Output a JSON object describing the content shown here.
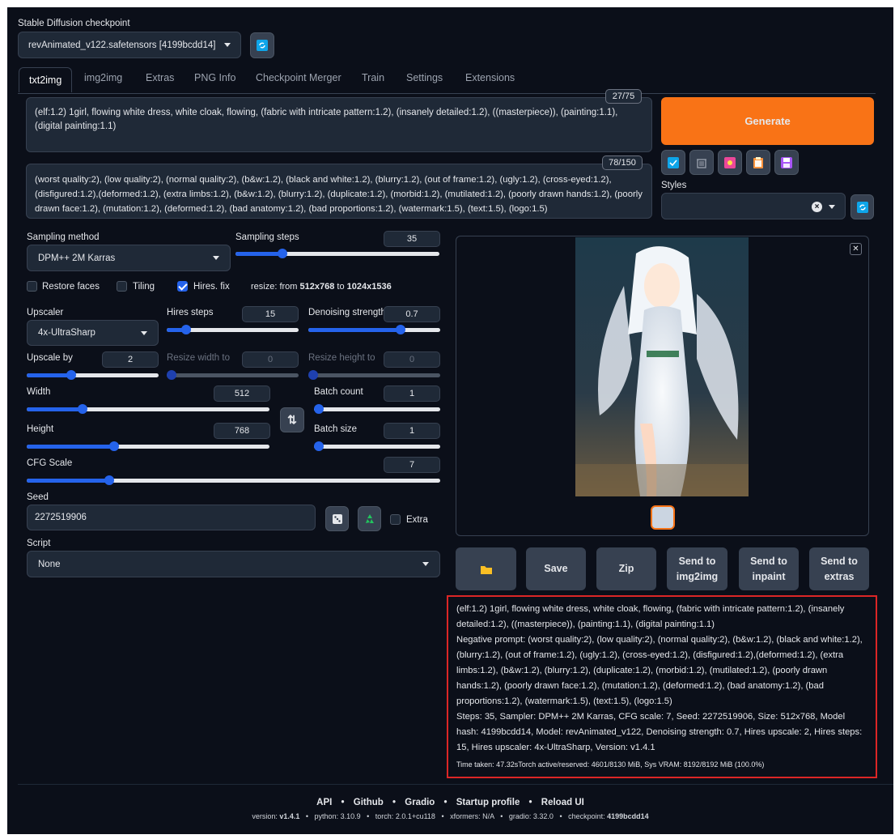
{
  "checkpoint": {
    "label": "Stable Diffusion checkpoint",
    "value": "revAnimated_v122.safetensors [4199bcdd14]"
  },
  "tabs": [
    "txt2img",
    "img2img",
    "Extras",
    "PNG Info",
    "Checkpoint Merger",
    "Train",
    "Settings",
    "Extensions"
  ],
  "prompt": {
    "text": "(elf:1.2) 1girl, flowing white dress, white cloak, flowing, (fabric with intricate pattern:1.2), (insanely detailed:1.2), ((masterpiece)), (painting:1.1), (digital painting:1.1)",
    "counter": "27/75"
  },
  "negative_prompt": {
    "text": "(worst quality:2), (low quality:2), (normal quality:2), (b&w:1.2), (black and white:1.2), (blurry:1.2), (out of frame:1.2), (ugly:1.2), (cross-eyed:1.2), (disfigured:1.2),(deformed:1.2), (extra limbs:1.2), (b&w:1.2), (blurry:1.2), (duplicate:1.2), (morbid:1.2), (mutilated:1.2), (poorly drawn hands:1.2), (poorly drawn face:1.2), (mutation:1.2), (deformed:1.2), (bad anatomy:1.2), (bad proportions:1.2), (watermark:1.5), (text:1.5), (logo:1.5)",
    "counter": "78/150"
  },
  "generate_label": "Generate",
  "styles_label": "Styles",
  "sampling": {
    "method_label": "Sampling method",
    "method": "DPM++ 2M Karras",
    "steps_label": "Sampling steps",
    "steps": "35",
    "steps_fraction": 0.23
  },
  "checkboxes": {
    "restore_faces": "Restore faces",
    "tiling": "Tiling",
    "hires_fix": "Hires. fix"
  },
  "resize_info": {
    "prefix": "resize: from ",
    "from": "512x768",
    "mid": " to ",
    "to": "1024x1536"
  },
  "hires": {
    "upscaler_label": "Upscaler",
    "upscaler": "4x-UltraSharp",
    "steps_label": "Hires steps",
    "steps": "15",
    "steps_fraction": 0.15,
    "denoise_label": "Denoising strength",
    "denoise": "0.7",
    "denoise_fraction": 0.7,
    "upscale_by_label": "Upscale by",
    "upscale_by": "2",
    "upscale_fraction": 0.34,
    "resize_w_label": "Resize width to",
    "resize_w": "0",
    "resize_h_label": "Resize height to",
    "resize_h": "0"
  },
  "size": {
    "width_label": "Width",
    "width": "512",
    "width_fraction": 0.23,
    "height_label": "Height",
    "height": "768",
    "height_fraction": 0.36
  },
  "batch": {
    "count_label": "Batch count",
    "count": "1",
    "size_label": "Batch size",
    "size": "1"
  },
  "cfg": {
    "label": "CFG Scale",
    "value": "7",
    "fraction": 0.2
  },
  "seed": {
    "label": "Seed",
    "value": "2272519906",
    "extra_label": "Extra"
  },
  "script": {
    "label": "Script",
    "value": "None"
  },
  "actions": {
    "save": "Save",
    "zip": "Zip",
    "send_img2img": "Send to img2img",
    "send_inpaint": "Send to inpaint",
    "send_extras": "Send to extras"
  },
  "info": {
    "prompt": "(elf:1.2) 1girl, flowing white dress, white cloak, flowing, (fabric with intricate pattern:1.2), (insanely detailed:1.2), ((masterpiece)), (painting:1.1), (digital painting:1.1)",
    "negative": "Negative prompt: (worst quality:2), (low quality:2), (normal quality:2), (b&w:1.2), (black and white:1.2), (blurry:1.2), (out of frame:1.2), (ugly:1.2), (cross-eyed:1.2), (disfigured:1.2),(deformed:1.2), (extra limbs:1.2), (b&w:1.2), (blurry:1.2), (duplicate:1.2), (morbid:1.2), (mutilated:1.2), (poorly drawn hands:1.2), (poorly drawn face:1.2), (mutation:1.2), (deformed:1.2), (bad anatomy:1.2), (bad proportions:1.2), (watermark:1.5), (text:1.5), (logo:1.5)",
    "params": "Steps: 35, Sampler: DPM++ 2M Karras, CFG scale: 7, Seed: 2272519906, Size: 512x768, Model hash: 4199bcdd14, Model: revAnimated_v122, Denoising strength: 0.7, Hires upscale: 2, Hires steps: 15, Hires upscaler: 4x-UltraSharp, Version: v1.4.1",
    "time": "Time taken: 47.32sTorch active/reserved: 4601/8130 MiB, Sys VRAM: 8192/8192 MiB (100.0%)"
  },
  "footer": {
    "links": [
      "API",
      "Github",
      "Gradio",
      "Startup profile",
      "Reload UI"
    ],
    "sep": "•",
    "versions": [
      {
        "k": "version: ",
        "v": "v1.4.1"
      },
      {
        "k": "python: ",
        "v": "3.10.9"
      },
      {
        "k": "torch: ",
        "v": "2.0.1+cu118"
      },
      {
        "k": "xformers: ",
        "v": "N/A"
      },
      {
        "k": "gradio: ",
        "v": "3.32.0"
      },
      {
        "k": "checkpoint: ",
        "v": "4199bcdd14"
      }
    ]
  },
  "colors": {
    "bg": "#0b0f19",
    "panel": "#1f2937",
    "accent": "#2563eb",
    "generate": "#f97316",
    "highlight_box": "#dc2626"
  }
}
